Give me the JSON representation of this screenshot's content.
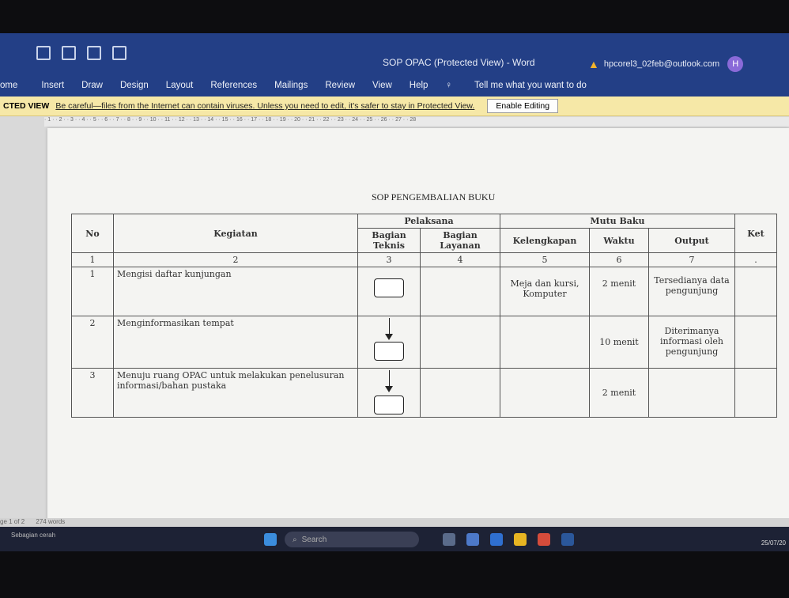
{
  "window": {
    "title": "SOP OPAC (Protected View)  -  Word",
    "account": "hpcorel3_02feb@outlook.com",
    "avatar": "H"
  },
  "ribbon": [
    "ome",
    "Insert",
    "Draw",
    "Design",
    "Layout",
    "References",
    "Mailings",
    "Review",
    "View",
    "Help"
  ],
  "tell_me": "Tell me what you want to do",
  "protected": {
    "label": "CTED VIEW",
    "message": "Be careful—files from the Internet can contain viruses. Unless you need to edit, it's safer to stay in Protected View.",
    "button": "Enable Editing"
  },
  "document": {
    "title": "SOP PENGEMBALIAN BUKU",
    "headers": {
      "no": "No",
      "kegiatan": "Kegiatan",
      "pelaksana": "Pelaksana",
      "teknis": "Bagian Teknis",
      "layanan": "Bagian Layanan",
      "mutu": "Mutu Baku",
      "kelengkapan": "Kelengkapan",
      "waktu": "Waktu",
      "output": "Output",
      "ket": "Ket"
    },
    "numbers": [
      "1",
      "2",
      "3",
      "4",
      "5",
      "6",
      "7",
      "."
    ],
    "rows": [
      {
        "no": "1",
        "kegiatan": "Mengisi daftar kunjungan",
        "kelengkapan": "Meja dan kursi, Komputer",
        "waktu": "2 menit",
        "output": "Tersedianya data pengunjung"
      },
      {
        "no": "2",
        "kegiatan": "Menginformasikan tempat",
        "kelengkapan": "",
        "waktu": "10 menit",
        "output": "Diterimanya informasi oleh pengunjung"
      },
      {
        "no": "3",
        "kegiatan": "Menuju ruang OPAC untuk melakukan penelusuran informasi/bahan pustaka",
        "kelengkapan": "",
        "waktu": "2 menit",
        "output": ""
      }
    ]
  },
  "status": {
    "page": "ge 1 of 2",
    "words": "274 words"
  },
  "taskbar": {
    "search": "Search",
    "weather": "Sebagian cerah",
    "date": "25/07/20"
  }
}
